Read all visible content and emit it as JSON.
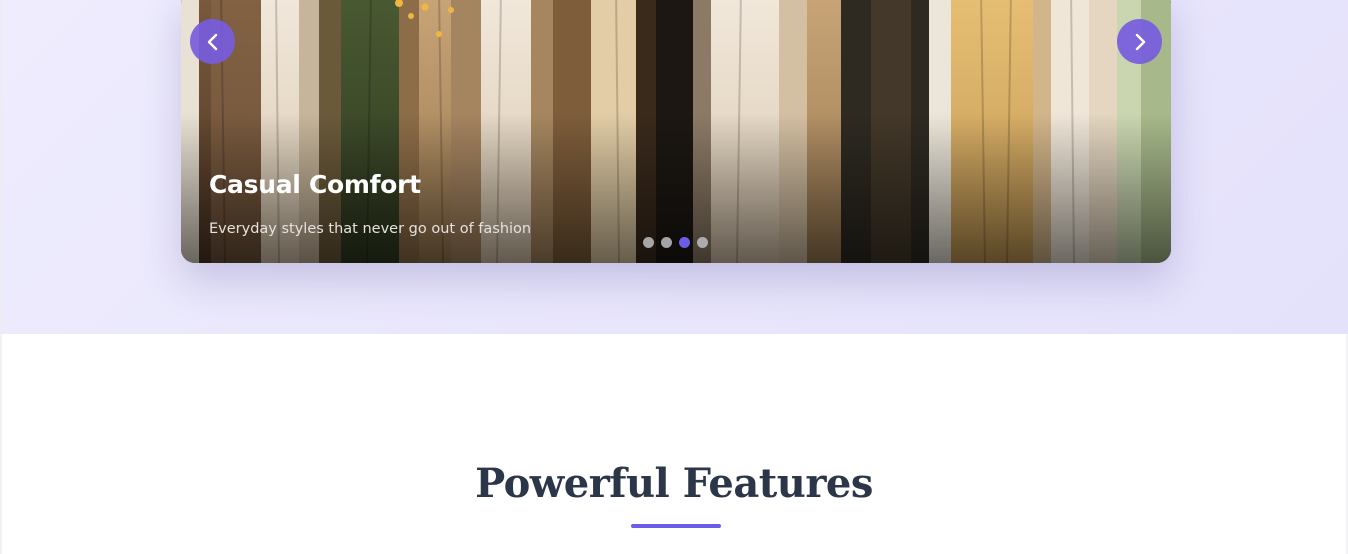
{
  "hero": {
    "slide": {
      "title": "Casual Comfort",
      "subtitle": "Everyday styles that never go out of fashion",
      "image": "clothing-rack-photo"
    },
    "controls": {
      "prev_icon": "chevron-left-icon",
      "next_icon": "chevron-right-icon"
    },
    "dots": [
      {
        "active": false
      },
      {
        "active": false
      },
      {
        "active": true
      },
      {
        "active": false
      }
    ],
    "accent_color": "#6c5ce7"
  },
  "features": {
    "title": "Powerful Features"
  }
}
